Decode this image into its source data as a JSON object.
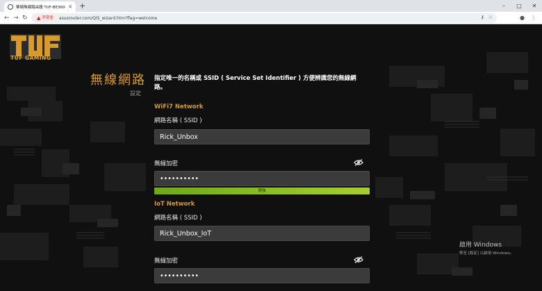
{
  "browser": {
    "tab_title": "華碩無線路由器 TUF-BE3600",
    "new_tab": "+",
    "window_controls": [
      "–",
      "□",
      "✕"
    ],
    "security_label": "不安全",
    "url": "asusrouter.com/QIS_wizard.htm?flag=welcome"
  },
  "brand": {
    "logo_text": "TUF GAMING"
  },
  "header": {
    "title": "無線網路",
    "subtitle": "設定"
  },
  "description": "指定唯一的名稱或 SSID ( Service Set Identifier ) 方便辨識您的無線網路。",
  "wifi7": {
    "group_label": "WiFi7 Network",
    "ssid_label": "網路名稱 ( SSID )",
    "ssid_value": "Rick_Unbox",
    "password_label": "無線加密",
    "password_value": "••••••••••",
    "strength_label": "很強"
  },
  "iot": {
    "group_label": "IoT Network",
    "ssid_label": "網路名稱 ( SSID )",
    "ssid_value": "Rick_Unbox_IoT",
    "password_label": "無線加密",
    "password_value": "••••••••••"
  },
  "watermark": {
    "line1": "啟用 Windows",
    "line2": "移至 [設定] 以啟用 Windows。"
  },
  "colors": {
    "accent": "#d69a2a",
    "strength": "#8cc22a",
    "background": "#101010"
  }
}
